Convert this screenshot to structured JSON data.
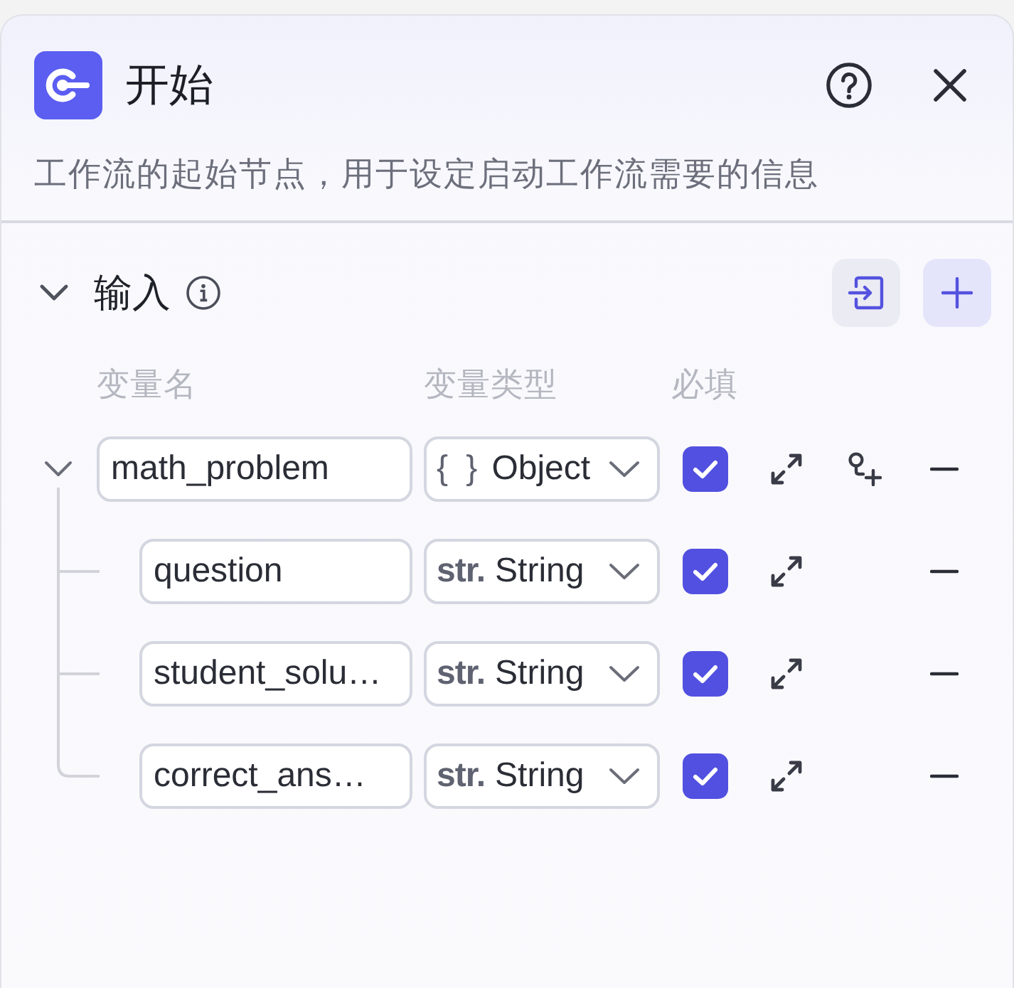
{
  "panel": {
    "title": "开始",
    "description": "工作流的起始节点，用于设定启动工作流需要的信息"
  },
  "section": {
    "title": "输入",
    "expanded": true
  },
  "columns": [
    "变量名",
    "变量类型",
    "必填"
  ],
  "variables": [
    {
      "name": "math_problem",
      "kind": "object",
      "type_symbol": "{ }",
      "type": "Object",
      "required": true,
      "expanded": true,
      "children": [
        {
          "name": "question",
          "kind": "string",
          "type_symbol": "str.",
          "type": "String",
          "required": true
        },
        {
          "name": "student_solu…",
          "kind": "string",
          "type_symbol": "str.",
          "type": "String",
          "required": true
        },
        {
          "name": "correct_ans…",
          "kind": "string",
          "type_symbol": "str.",
          "type": "String",
          "required": true
        }
      ]
    }
  ]
}
